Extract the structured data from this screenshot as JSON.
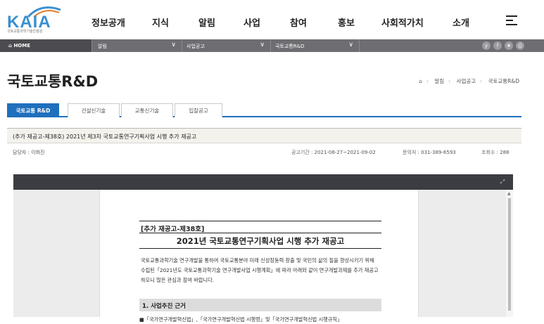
{
  "logo": {
    "text": "KAIA",
    "subtitle": "국토교통과학기술진흥원"
  },
  "menu": [
    "정보공개",
    "지식",
    "알림",
    "사업",
    "참여",
    "홍보",
    "사회적가치",
    "소개"
  ],
  "breadcrumb_bar": {
    "home": "HOME",
    "segments": [
      "알림",
      "사업공고",
      "국토교통R&D"
    ],
    "social": [
      "y",
      "f",
      "★",
      "⎙"
    ]
  },
  "page": {
    "title": "국토교통R&D",
    "crumbs": [
      "알림",
      "사업공고",
      "국토교통R&D"
    ]
  },
  "tabs": [
    {
      "label": "국토교통 R&D",
      "active": true
    },
    {
      "label": "건설신기술",
      "active": false
    },
    {
      "label": "교통신기술",
      "active": false
    },
    {
      "label": "입찰공고",
      "active": false
    }
  ],
  "notice": {
    "title": "(추가 재공고-제38호) 2021년 제3차 국토교통연구기획사업 시행 추가 재공고",
    "manager": "담당자 : 이화진",
    "period_label": "공고기간 :",
    "period": "2021-08-27~2021-09-02",
    "contact_label": "문의처 :",
    "contact": "031-389-6593",
    "views_label": "조회수 :",
    "views": "288"
  },
  "document": {
    "header": "[추가 재공고-제38호]",
    "title": "2021년 국토교통연구기획사업 시행 추가 재공고",
    "body": "국토교통과학기술 연구개발을 통하여 국토교통분야 미래 신성장동력 창출 및 국민의 삶의 질을 향상시키기 위해 수립된「2021년도 국토교통과학기술 연구개발사업 시행계획」에 따라 아래와 같이 연구개발과제를 추가 재공고하오니 많은 관심과 참여 바랍니다.",
    "section": "1. 사업추진 근거",
    "bullet": "■「국가연구개발혁신법」,「국가연구개발혁신법 시행령」및「국가연구개발혁신법 시행규칙」"
  }
}
